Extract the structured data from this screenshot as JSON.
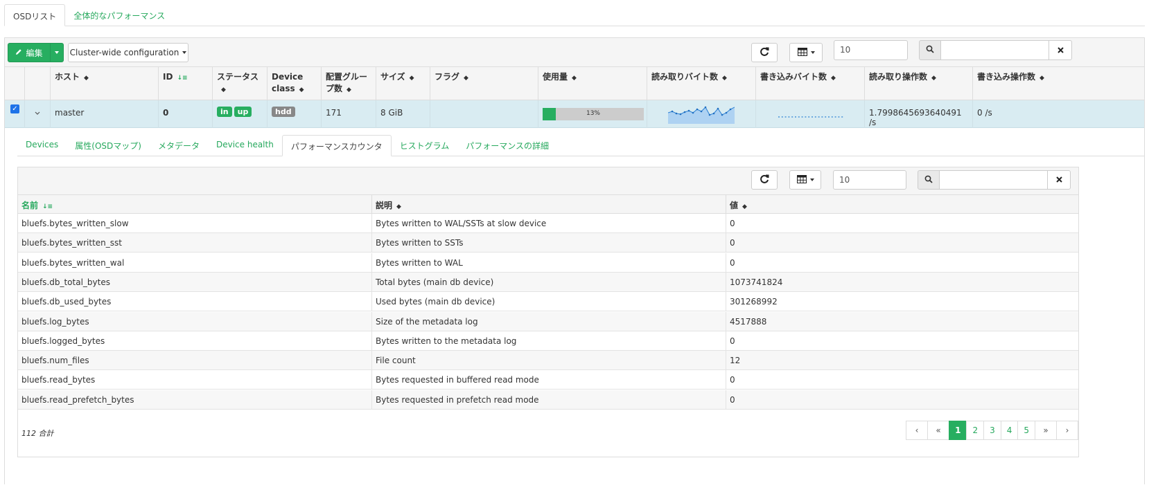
{
  "top_tabs": [
    {
      "label": "OSDリスト",
      "active": true
    },
    {
      "label": "全体的なパフォーマンス",
      "active": false
    }
  ],
  "toolbar": {
    "edit_label": "編集",
    "cluster_config_label": "Cluster-wide configuration",
    "page_size": "10",
    "search_value": ""
  },
  "table": {
    "columns": [
      "ホスト",
      "ID",
      "ステータス",
      "Device class",
      "配置グループ数",
      "サイズ",
      "フラグ",
      "使用量",
      "読み取りバイト数",
      "書き込みバイト数",
      "読み取り操作数",
      "書き込み操作数"
    ],
    "column_lines": {
      "device_class": [
        "Device",
        "class"
      ],
      "pg_count": [
        "配置グルー",
        "プ数"
      ]
    },
    "row": {
      "selected": true,
      "host": "master",
      "id": "0",
      "status": [
        "in",
        "up"
      ],
      "device_class": "hdd",
      "pg_count": "171",
      "size": "8 GiB",
      "flags": "",
      "usage_label": "13%",
      "usage_fraction": 0.13,
      "read_ops": "1.7998645693640491 /s",
      "write_ops": "0 /s"
    }
  },
  "detail_tabs": [
    {
      "label": "Devices",
      "active": false
    },
    {
      "label": "属性(OSDマップ)",
      "active": false
    },
    {
      "label": "メタデータ",
      "active": false
    },
    {
      "label": "Device health",
      "active": false
    },
    {
      "label": "パフォーマンスカウンタ",
      "active": true
    },
    {
      "label": "ヒストグラム",
      "active": false
    },
    {
      "label": "パフォーマンスの詳細",
      "active": false
    }
  ],
  "counters": {
    "page_size": "10",
    "search_value": "",
    "columns": [
      "名前",
      "説明",
      "値"
    ],
    "rows": [
      {
        "name": "bluefs.bytes_written_slow",
        "desc": "Bytes written to WAL/SSTs at slow device",
        "value": "0"
      },
      {
        "name": "bluefs.bytes_written_sst",
        "desc": "Bytes written to SSTs",
        "value": "0"
      },
      {
        "name": "bluefs.bytes_written_wal",
        "desc": "Bytes written to WAL",
        "value": "0"
      },
      {
        "name": "bluefs.db_total_bytes",
        "desc": "Total bytes (main db device)",
        "value": "1073741824"
      },
      {
        "name": "bluefs.db_used_bytes",
        "desc": "Used bytes (main db device)",
        "value": "301268992"
      },
      {
        "name": "bluefs.log_bytes",
        "desc": "Size of the metadata log",
        "value": "4517888"
      },
      {
        "name": "bluefs.logged_bytes",
        "desc": "Bytes written to the metadata log",
        "value": "0"
      },
      {
        "name": "bluefs.num_files",
        "desc": "File count",
        "value": "12"
      },
      {
        "name": "bluefs.read_bytes",
        "desc": "Bytes requested in buffered read mode",
        "value": "0"
      },
      {
        "name": "bluefs.read_prefetch_bytes",
        "desc": "Bytes requested in prefetch read mode",
        "value": "0"
      }
    ],
    "total_label": "112 合計",
    "pagination": {
      "first": "‹",
      "prev": "«",
      "pages": [
        "1",
        "2",
        "3",
        "4",
        "5"
      ],
      "active_page": "1",
      "next": "»",
      "last": "›"
    }
  },
  "colors": {
    "accent": "#27ae60",
    "selected_row": "#d9ecf2"
  },
  "icons": [
    "pencil-icon",
    "refresh-icon",
    "table-columns-icon",
    "search-icon",
    "clear-icon",
    "checkbox-icon",
    "chevron-down-icon",
    "sort-icon"
  ]
}
